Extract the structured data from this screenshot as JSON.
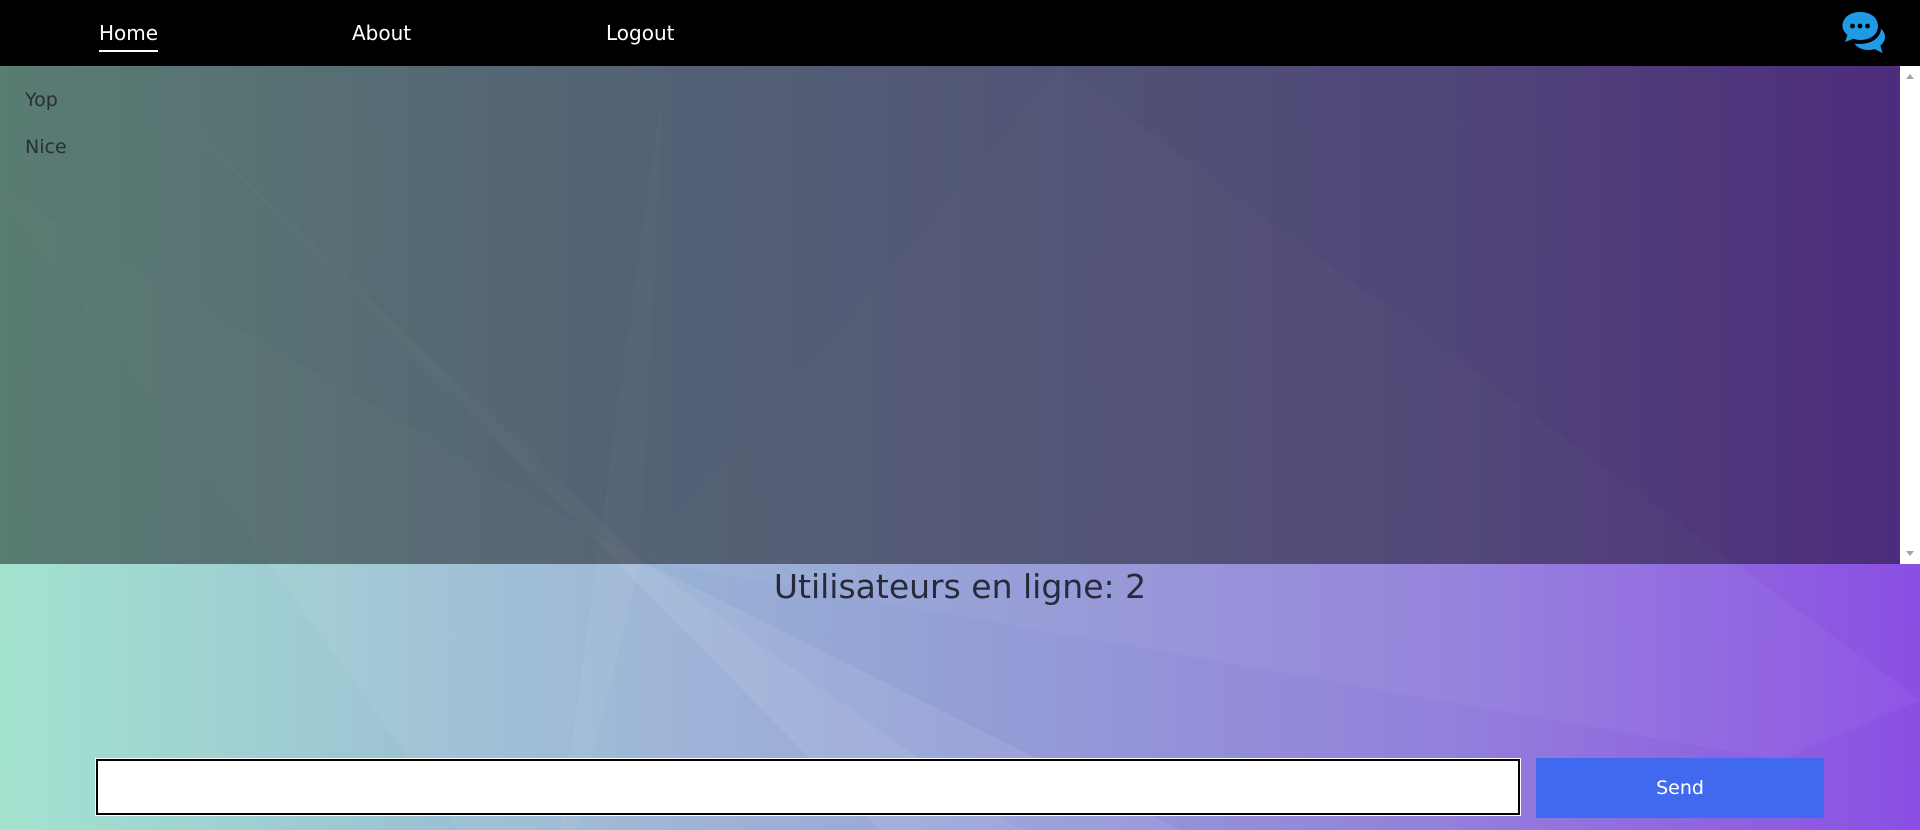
{
  "nav": {
    "home_label": "Home",
    "about_label": "About",
    "logout_label": "Logout",
    "brand_icon": "chat-bubbles-icon"
  },
  "messages": [
    "Yop",
    "Nice"
  ],
  "status": {
    "online_users": "Utilisateurs en ligne: 2"
  },
  "composer": {
    "value": "",
    "placeholder": "",
    "send_label": "Send"
  },
  "colors": {
    "navbar": "#000000",
    "accent": "#4169f0",
    "brand_icon": "#1f9be6"
  }
}
